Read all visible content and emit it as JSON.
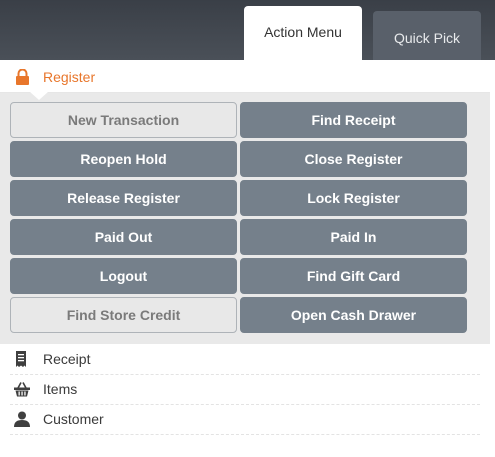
{
  "tabs": {
    "action_menu": "Action Menu",
    "quick_pick": "Quick Pick"
  },
  "register_section": {
    "title": "Register",
    "icon": "lock-icon",
    "accent_color": "#e8762b"
  },
  "buttons": {
    "new_transaction": "New Transaction",
    "find_receipt": "Find Receipt",
    "reopen_hold": "Reopen Hold",
    "close_register": "Close Register",
    "release_register": "Release Register",
    "lock_register": "Lock Register",
    "paid_out": "Paid Out",
    "paid_in": "Paid In",
    "logout": "Logout",
    "find_gift_card": "Find Gift Card",
    "find_store_credit": "Find Store Credit",
    "open_cash_drawer": "Open Cash Drawer"
  },
  "nav": {
    "receipt": {
      "label": "Receipt",
      "icon": "receipt-icon"
    },
    "items": {
      "label": "Items",
      "icon": "basket-icon"
    },
    "customer": {
      "label": "Customer",
      "icon": "user-icon"
    }
  }
}
